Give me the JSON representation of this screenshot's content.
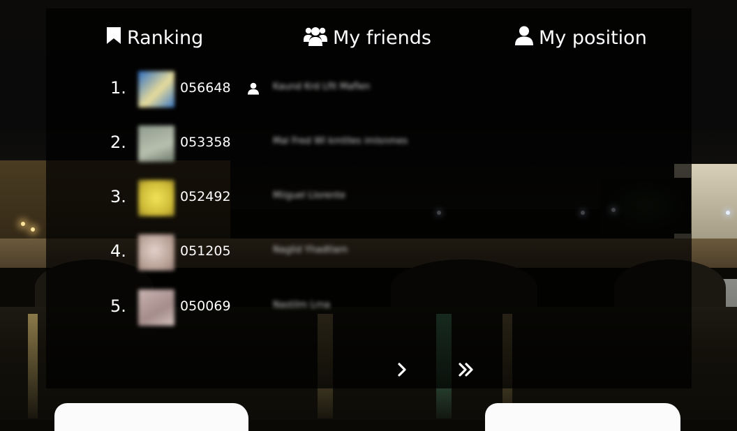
{
  "tabs": [
    {
      "label": "Ranking",
      "icon": "bookmark-icon"
    },
    {
      "label": "My friends",
      "icon": "users-icon"
    },
    {
      "label": "My position",
      "icon": "user-icon"
    }
  ],
  "ranking": [
    {
      "rank": "1.",
      "score": "056648",
      "name": "Kaund Krd Lfit Maflen",
      "avatar_color": "#3a78c8",
      "is_me": true
    },
    {
      "rank": "2.",
      "score": "053358",
      "name": "Mal Fred Wl kmtlles imlsnmes",
      "avatar_color": "#a8b3a0",
      "is_me": false
    },
    {
      "rank": "3.",
      "score": "052492",
      "name": "Miiguel Llorente",
      "avatar_color": "#d9cc48",
      "is_me": false
    },
    {
      "rank": "4.",
      "score": "051205",
      "name": "Naglid Yhadtlam",
      "avatar_color": "#c8b4ac",
      "is_me": false
    },
    {
      "rank": "5.",
      "score": "050069",
      "name": "Nastilm Lrna",
      "avatar_color": "#bfaaa8",
      "is_me": false
    }
  ],
  "pagination": {
    "next_icon": "chevron-right-icon",
    "last_icon": "double-chevron-right-icon"
  }
}
